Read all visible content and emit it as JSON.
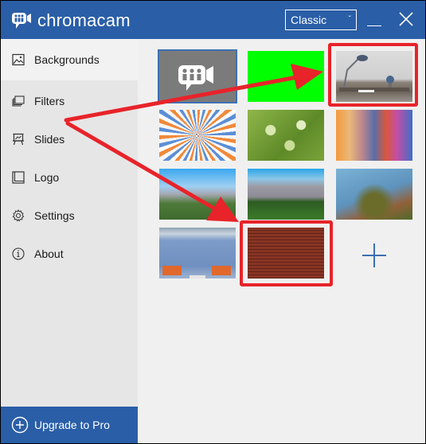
{
  "app": {
    "title": "chromacam",
    "mode_select": {
      "value": "Classic"
    }
  },
  "sidebar": {
    "items": [
      {
        "label": "Backgrounds",
        "icon": "image-icon",
        "active": true
      },
      {
        "label": "Filters",
        "icon": "layers-icon",
        "active": false
      },
      {
        "label": "Slides",
        "icon": "presentation-icon",
        "active": false
      },
      {
        "label": "Logo",
        "icon": "logo-frame-icon",
        "active": false
      },
      {
        "label": "Settings",
        "icon": "gear-icon",
        "active": false
      },
      {
        "label": "About",
        "icon": "info-icon",
        "active": false
      }
    ],
    "upgrade_label": "Upgrade to Pro"
  },
  "backgrounds": {
    "thumbnails": [
      {
        "name": "none-chromacam-logo",
        "selected": true
      },
      {
        "name": "green-screen",
        "selected": false
      },
      {
        "name": "desk-lamp-white-brick",
        "selected": false,
        "highlighted": true
      },
      {
        "name": "sunburst-rays",
        "selected": false
      },
      {
        "name": "green-bokeh",
        "selected": false
      },
      {
        "name": "colorful-speech-bubbles",
        "selected": false
      },
      {
        "name": "palm-springs-street",
        "selected": false
      },
      {
        "name": "mountain-palms",
        "selected": false
      },
      {
        "name": "ferris-wheel-palm",
        "selected": false
      },
      {
        "name": "modern-lounge",
        "selected": false
      },
      {
        "name": "red-brick-wall",
        "selected": false,
        "highlighted": true
      }
    ],
    "add_button": "add-background"
  },
  "colors": {
    "brand_blue": "#2a5ea7",
    "highlight_red": "#e8232a",
    "chroma_green": "#00ff00"
  }
}
